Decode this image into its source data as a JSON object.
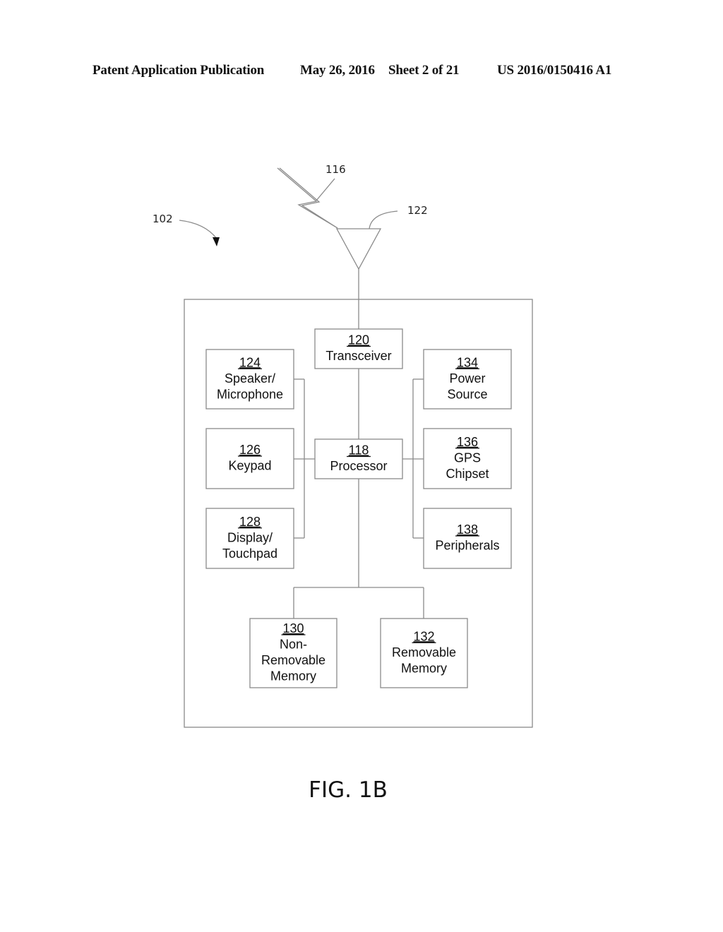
{
  "header": {
    "publication": "Patent Application Publication",
    "date_sheet": "May 26, 2016",
    "sheet": "Sheet 2 of 21",
    "patent_number": "US 2016/0150416 A1"
  },
  "diagram": {
    "device_ref": "102",
    "signal_ref": "116",
    "antenna_ref": "122",
    "blocks": {
      "transceiver": {
        "ref": "120",
        "lines": [
          "Transceiver"
        ]
      },
      "speaker": {
        "ref": "124",
        "lines": [
          "Speaker/",
          "Microphone"
        ]
      },
      "keypad": {
        "ref": "126",
        "lines": [
          "Keypad"
        ]
      },
      "display": {
        "ref": "128",
        "lines": [
          "Display/",
          "Touchpad"
        ]
      },
      "processor": {
        "ref": "118",
        "lines": [
          "Processor"
        ]
      },
      "power": {
        "ref": "134",
        "lines": [
          "Power",
          "Source"
        ]
      },
      "gps": {
        "ref": "136",
        "lines": [
          "GPS",
          "Chipset"
        ]
      },
      "peripherals": {
        "ref": "138",
        "lines": [
          "Peripherals"
        ]
      },
      "nonremovable": {
        "ref": "130",
        "lines": [
          "Non-",
          "Removable",
          "Memory"
        ]
      },
      "removable": {
        "ref": "132",
        "lines": [
          "Removable",
          "Memory"
        ]
      }
    },
    "figure_label": "FIG. 1B"
  }
}
